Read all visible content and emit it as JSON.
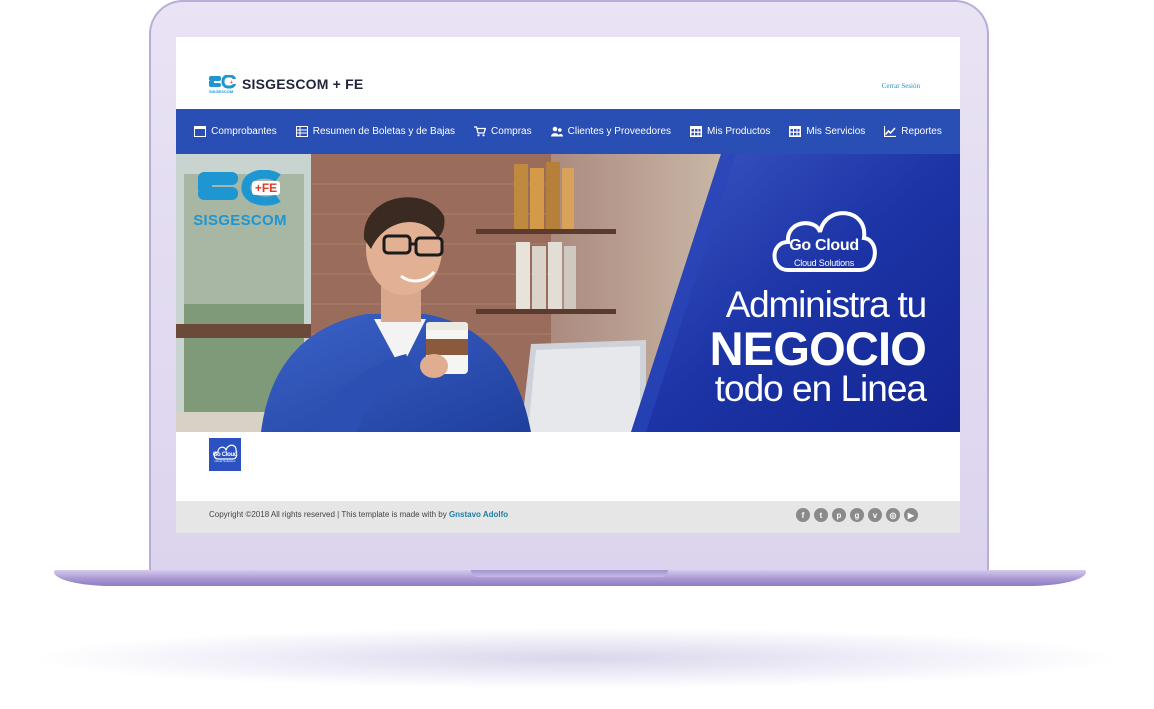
{
  "app": {
    "title": "SISGESCOM + FE",
    "logout_label": "Cerrar Sesión"
  },
  "nav": {
    "items": [
      {
        "label": "Comprobantes",
        "icon": "window-icon"
      },
      {
        "label": "Resumen de Boletas y de Bajas",
        "icon": "list-icon"
      },
      {
        "label": "Compras",
        "icon": "cart-icon"
      },
      {
        "label": "Clientes y Proveedores",
        "icon": "users-icon"
      },
      {
        "label": "Mis Productos",
        "icon": "grid-icon"
      },
      {
        "label": "Mis Servicios",
        "icon": "grid-icon"
      },
      {
        "label": "Reportes",
        "icon": "chart-icon"
      }
    ]
  },
  "banner": {
    "logo_text": "SISGESCOM",
    "logo_badge": "+FE",
    "cloud_brand": "Go Cloud",
    "cloud_tagline": "Cloud Solutions",
    "headline_line1": "Administra tu",
    "headline_line2": "NEGOCIO",
    "headline_line3": "todo en Linea"
  },
  "small_logo": {
    "brand": "Go Cloud",
    "tagline": "Cloud Solutions"
  },
  "footer": {
    "copyright": "Copyright ©2018 All rights reserved | This template is made with  by ",
    "author": "Gnstavo Adolfo",
    "social": [
      {
        "name": "facebook-icon",
        "glyph": "f"
      },
      {
        "name": "twitter-icon",
        "glyph": "t"
      },
      {
        "name": "pinterest-icon",
        "glyph": "p"
      },
      {
        "name": "google-plus-icon",
        "glyph": "g"
      },
      {
        "name": "vimeo-icon",
        "glyph": "v"
      },
      {
        "name": "instagram-icon",
        "glyph": "◎"
      },
      {
        "name": "youtube-icon",
        "glyph": "▶"
      }
    ]
  },
  "colors": {
    "nav_bg": "#2a4fb4",
    "banner_blue": "#1c34a6",
    "logo_blue": "#1e96d2",
    "badge_red": "#d93a2b",
    "link_teal": "#1e7fa3"
  }
}
